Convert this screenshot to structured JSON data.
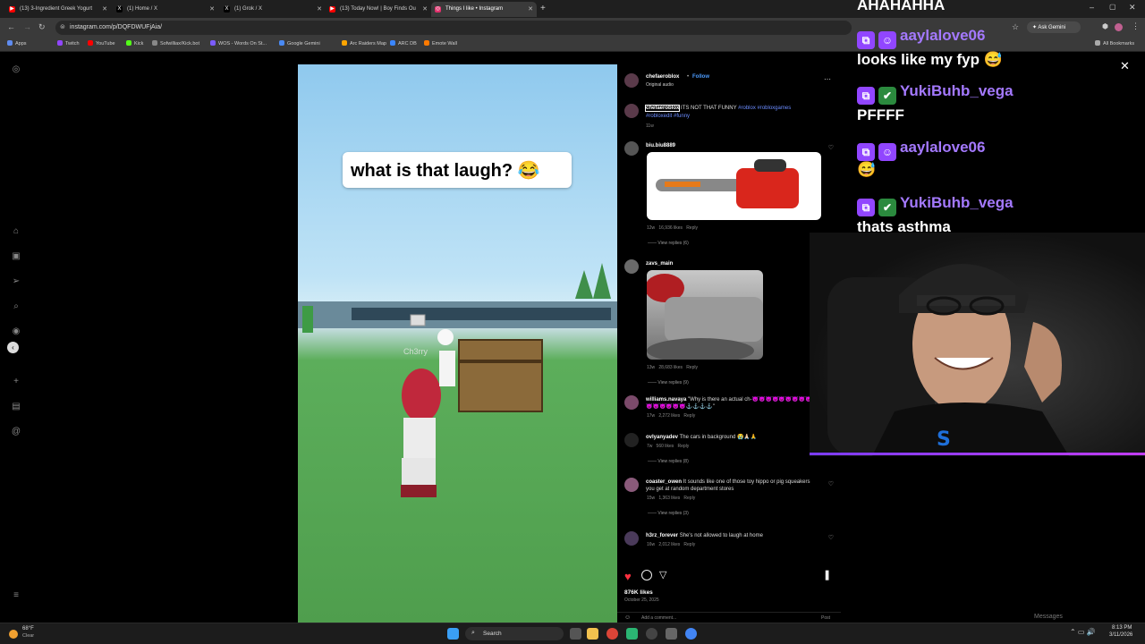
{
  "tabs": [
    {
      "label": "(13) 3-Ingredient Greek Yogurt",
      "fav": "▶",
      "favColor": "#ff0000",
      "active": false
    },
    {
      "label": "(1) Home / X",
      "fav": "X",
      "favColor": "#000000",
      "active": false
    },
    {
      "label": "(1) Grok / X",
      "fav": "X",
      "favColor": "#000000",
      "active": false
    },
    {
      "label": "(13) Today Now! | Boy Finds Ou",
      "fav": "▶",
      "favColor": "#ff0000",
      "active": false
    },
    {
      "label": "Things I like • Instagram",
      "fav": "◎",
      "favColor": "#e1306c",
      "active": true
    }
  ],
  "address": {
    "url": "instagram.com/p/DQFDWUFjAia/",
    "ask_gemini": "Ask Gemini"
  },
  "bookmarks": [
    {
      "label": "Apps",
      "color": "#5f8cf0"
    },
    {
      "label": "Twitch",
      "color": "#9146ff"
    },
    {
      "label": "YouTube",
      "color": "#ff0000"
    },
    {
      "label": "Kick",
      "color": "#53fc18"
    },
    {
      "label": "Sofwilliax/Kick.bot",
      "color": "#888888"
    },
    {
      "label": "WOS - Words On St...",
      "color": "#7b5cff"
    },
    {
      "label": "Google Gemini",
      "color": "#4a8af4"
    },
    {
      "label": "Arc Raiders Map",
      "color": "#ffa500"
    },
    {
      "label": "ARC DB",
      "color": "#3a86ff"
    },
    {
      "label": "Emote Wall",
      "color": "#ff7a00"
    }
  ],
  "all_bookmarks": "All Bookmarks",
  "video": {
    "caption": "what is that laugh? 😂",
    "player_tag": "Ch3rry"
  },
  "post": {
    "author": "chefaeroblox",
    "follow": "Follow",
    "audio": "Original audio",
    "caption_user": "chefaeroblox",
    "caption_text": "ITS NOT THAT FUNNY",
    "caption_tags": "#roblox #robloxgames #robloxedit #funny",
    "caption_age": "11w",
    "likes": "876K likes",
    "date": "October 25, 2025",
    "add_comment": "Add a comment...",
    "post_btn": "Post"
  },
  "comments": [
    {
      "user": "biu.biu8889",
      "text": "",
      "meta": "12w   16,936 likes   Reply",
      "replies": "View replies (6)",
      "image": "chainsaw"
    },
    {
      "user": "zavs_main",
      "text": "",
      "meta": "13w   28,683 likes   Reply",
      "replies": "View replies (9)",
      "image": "car"
    },
    {
      "user": "williams.navaya",
      "text": "\"Why is there an actual ch-😈😈😈😈😈😈😈😈😈😈😈😈😈😈😈⚓⚓⚓⚓\"",
      "meta": "17w   2,272 likes   Reply",
      "replies": "",
      "image": ""
    },
    {
      "user": "ovlyanyadev",
      "text": "The cars in background 😭🙏🏻🙏",
      "meta": "7w   560 likes   Reply",
      "replies": "View replies (8)",
      "image": ""
    },
    {
      "user": "coaster_owen",
      "text": "It sounds like one of those toy hippo or pig squeakers you get at random department stores",
      "meta": "15w   1,363 likes   Reply",
      "replies": "View replies (3)",
      "image": ""
    },
    {
      "user": "h3rz_forever",
      "text": "She's not allowed to laugh at home",
      "meta": "16w   2,012 likes   Reply",
      "replies": "",
      "image": ""
    }
  ],
  "chat": [
    {
      "user": "",
      "text": "AHAHAHHA"
    },
    {
      "user": "aaylalove06",
      "text": ""
    },
    {
      "user": "",
      "text": "looks like my fyp 😅"
    },
    {
      "user": "YukiBuhb_vega",
      "text": ""
    },
    {
      "user": "",
      "text": "PFFFF"
    },
    {
      "user": "aaylalove06",
      "text": ""
    },
    {
      "user": "",
      "text": "😅"
    },
    {
      "user": "YukiBuhb_vega",
      "text": ""
    },
    {
      "user": "",
      "text": "thats asthma"
    }
  ],
  "messages_label": "Messages",
  "taskbar": {
    "weather_temp": "68°F",
    "weather_desc": "Clear",
    "search": "Search",
    "time": "8:13 PM",
    "date": "3/11/2026"
  }
}
